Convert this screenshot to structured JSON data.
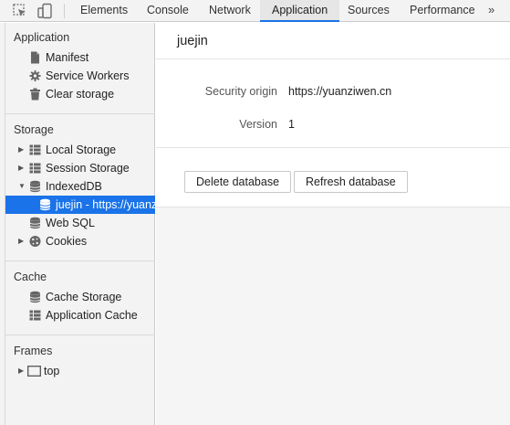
{
  "toolbar": {
    "tabs": [
      {
        "label": "Elements"
      },
      {
        "label": "Console"
      },
      {
        "label": "Network"
      },
      {
        "label": "Application"
      },
      {
        "label": "Sources"
      },
      {
        "label": "Performance"
      }
    ],
    "active_tab": "Application",
    "more": "»",
    "icons": [
      "inspect-element-icon",
      "device-toolbar-icon"
    ],
    "accent_color": "#1a73e8"
  },
  "sidebar": {
    "application": {
      "title": "Application",
      "items": [
        {
          "label": "Manifest",
          "icon": "file-icon"
        },
        {
          "label": "Service Workers",
          "icon": "gear-icon"
        },
        {
          "label": "Clear storage",
          "icon": "trash-icon"
        }
      ]
    },
    "storage": {
      "title": "Storage",
      "items": [
        {
          "label": "Local Storage",
          "icon": "grid-icon",
          "expanded": false
        },
        {
          "label": "Session Storage",
          "icon": "grid-icon",
          "expanded": false
        },
        {
          "label": "IndexedDB",
          "icon": "database-icon",
          "expanded": true
        },
        {
          "label": "juejin - https://yuanziwen.cn",
          "icon": "database-icon",
          "selected": true
        },
        {
          "label": "Web SQL",
          "icon": "database-icon"
        },
        {
          "label": "Cookies",
          "icon": "cookie-icon",
          "expanded": false
        }
      ]
    },
    "cache": {
      "title": "Cache",
      "items": [
        {
          "label": "Cache Storage",
          "icon": "database-icon"
        },
        {
          "label": "Application Cache",
          "icon": "grid-icon"
        }
      ]
    },
    "frames": {
      "title": "Frames",
      "items": [
        {
          "label": "top",
          "icon": "frame-icon",
          "expanded": false
        }
      ]
    }
  },
  "main": {
    "title": "juejin",
    "fields": [
      {
        "label": "Security origin",
        "value": "https://yuanziwen.cn"
      },
      {
        "label": "Version",
        "value": "1"
      }
    ],
    "buttons": [
      {
        "label": "Delete database"
      },
      {
        "label": "Refresh database"
      }
    ]
  }
}
